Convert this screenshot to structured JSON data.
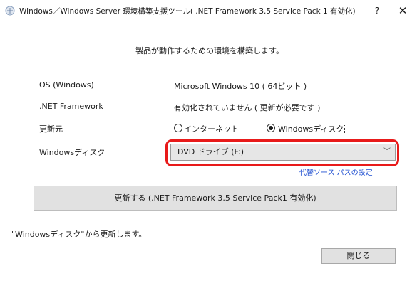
{
  "window": {
    "title": "Windows／Windows Server 環境構築支援ツール( .NET Framework 3.5 Service Pack 1 有効化)",
    "help_label": "?",
    "close_label": "✕"
  },
  "main": {
    "heading": "製品が動作するための環境を構築します。",
    "os_label": "OS (Windows)",
    "os_value": "Microsoft Windows 10 ( 64ビット )",
    "net_label": ".NET Framework",
    "net_value": "有効化されていません ( 更新が必要です )",
    "source_label": "更新元",
    "source_options": [
      {
        "label": "インターネット",
        "selected": false
      },
      {
        "label": "Windowsディスク",
        "selected": true
      }
    ],
    "disk_label": "Windowsディスク",
    "disk_select_value": "DVD ドライブ (F:)",
    "alt_source_link": "代替ソース パスの設定",
    "update_button": "更新する (.NET Framework 3.5 Service Pack1 有効化)",
    "status_text": "\"Windowsディスク\"から更新します。",
    "close_button": "閉じる"
  },
  "colors": {
    "highlight": "#e81a1a",
    "link": "#1f4fd1"
  }
}
